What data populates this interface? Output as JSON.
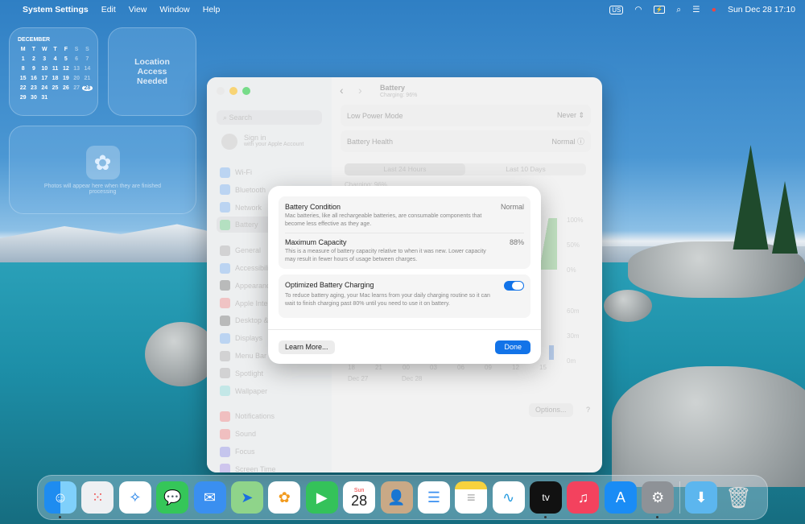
{
  "menubar": {
    "app": "System Settings",
    "items": [
      "Edit",
      "View",
      "Window",
      "Help"
    ],
    "input_source": "US",
    "datetime": "Sun Dec 28  17:10"
  },
  "widgets": {
    "calendar": {
      "month": "DECEMBER",
      "weekdays": [
        "M",
        "T",
        "W",
        "T",
        "F",
        "S",
        "S"
      ],
      "days": [
        1,
        2,
        3,
        4,
        5,
        6,
        7,
        8,
        9,
        10,
        11,
        12,
        13,
        14,
        15,
        16,
        17,
        18,
        19,
        20,
        21,
        22,
        23,
        24,
        25,
        26,
        27,
        28,
        29,
        30,
        31
      ],
      "today": 28
    },
    "weather": {
      "text": "Location Access Needed"
    },
    "photos": {
      "text": "Photos will appear here when they are finished processing"
    }
  },
  "settings": {
    "search_placeholder": "Search",
    "signin": {
      "title": "Sign in",
      "subtitle": "with your Apple Account"
    },
    "sidebar": [
      "Wi-Fi",
      "Bluetooth",
      "Network",
      "Battery",
      "General",
      "Accessibility",
      "Appearance",
      "Apple Intelligence",
      "Desktop & Dock",
      "Displays",
      "Menu Bar",
      "Spotlight",
      "Wallpaper",
      "Notifications",
      "Sound",
      "Focus",
      "Screen Time"
    ],
    "title": "Battery",
    "subtitle": "Charging: 96%",
    "low_power": {
      "label": "Low Power Mode",
      "value": "Never"
    },
    "health": {
      "label": "Battery Health",
      "value": "Normal"
    },
    "tabs": [
      "Last 24 Hours",
      "Last 10 Days"
    ],
    "chart_label": "Charging: 96%",
    "y_level": [
      "100%",
      "50%",
      "0%"
    ],
    "y_usage": [
      "60m",
      "30m",
      "0m"
    ],
    "x_ticks": [
      "18",
      "21",
      "00",
      "03",
      "06",
      "09",
      "12",
      "15"
    ],
    "dates": [
      "Dec 27",
      "Dec 28"
    ],
    "options": "Options...",
    "help": "?"
  },
  "modal": {
    "condition": {
      "title": "Battery Condition",
      "value": "Normal",
      "desc": "Mac batteries, like all rechargeable batteries, are consumable components that become less effective as they age."
    },
    "capacity": {
      "title": "Maximum Capacity",
      "value": "88%",
      "desc": "This is a measure of battery capacity relative to when it was new. Lower capacity may result in fewer hours of usage between charges."
    },
    "optimized": {
      "title": "Optimized Battery Charging",
      "enabled": true,
      "desc": "To reduce battery aging, your Mac learns from your daily charging routine so it can wait to finish charging past 80% until you need to use it on battery."
    },
    "learn_more": "Learn More...",
    "done": "Done"
  },
  "dock": {
    "calendar_day": "Sun",
    "calendar_date": "28",
    "tv": "tv"
  }
}
